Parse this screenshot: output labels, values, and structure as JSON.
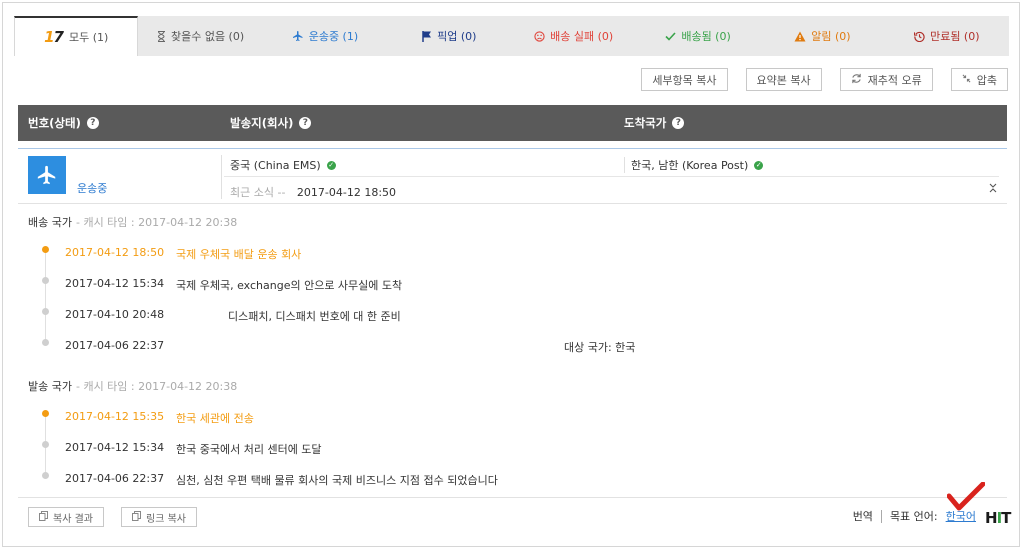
{
  "tabs": [
    {
      "label": "모두 (1)",
      "icon": "logo-17-icon",
      "active": true
    },
    {
      "label": "찾을수 없음 (0)",
      "icon": "hourglass-icon"
    },
    {
      "label": "운송중 (1)",
      "icon": "plane-icon"
    },
    {
      "label": "픽업 (0)",
      "icon": "flag-icon"
    },
    {
      "label": "배송 실패 (0)",
      "icon": "sad-face-icon"
    },
    {
      "label": "배송됨 (0)",
      "icon": "check-icon"
    },
    {
      "label": "알림 (0)",
      "icon": "warning-icon"
    },
    {
      "label": "만료됨 (0)",
      "icon": "history-icon"
    }
  ],
  "logo": {
    "part1": "1",
    "part2": "7"
  },
  "toolbar": {
    "copy_details": "세부항목 복사",
    "copy_summary": "요약본 복사",
    "retrack_error": "재추적 오류",
    "compress": "압축"
  },
  "header": {
    "number_status": "번호(상태)",
    "origin": "발송지(회사)",
    "destination": "도착국가"
  },
  "summary": {
    "status": "운송중",
    "origin": "중국 (China EMS)",
    "destination": "한국, 남한 (Korea Post)",
    "latest_label": "최근 소식 --",
    "latest_time": "2017-04-12 18:50"
  },
  "dest_section": {
    "title": "배송 국가",
    "cache": "- 캐시 타임 : 2017-04-12 20:38",
    "events": [
      {
        "time": "2017-04-12 18:50",
        "desc": "국제 우체국 배달 운송 회사"
      },
      {
        "time": "2017-04-12 15:34",
        "desc": "국제 우체국, exchange의 안으로 사무실에 도착"
      },
      {
        "time": "2017-04-10 20:48",
        "desc": "디스패치, 디스패치 번호에 대 한 준비"
      },
      {
        "time": "2017-04-06 22:37",
        "desc": "대상 국가: 한국"
      }
    ]
  },
  "origin_section": {
    "title": "발송 국가",
    "cache": "- 캐시 타임 : 2017-04-12 20:38",
    "events": [
      {
        "time": "2017-04-12 15:35",
        "desc": "한국 세관에 전송"
      },
      {
        "time": "2017-04-12 15:34",
        "desc": "한국 중국에서 처리 센터에 도달"
      },
      {
        "time": "2017-04-06 22:37",
        "desc": "심천, 심천 우편 택배 물류 회사의 국제 비즈니스 지점 접수 되었습니다"
      }
    ]
  },
  "footer": {
    "copy_result": "복사 결과",
    "copy_link": "링크 복사",
    "translate": "번역",
    "target_language_label": "목표 언어:",
    "target_language": "한국어"
  },
  "colors": {
    "accent_blue": "#2d8ee0",
    "accent_orange": "#f39c12",
    "header_bg": "#5a5a5a"
  }
}
